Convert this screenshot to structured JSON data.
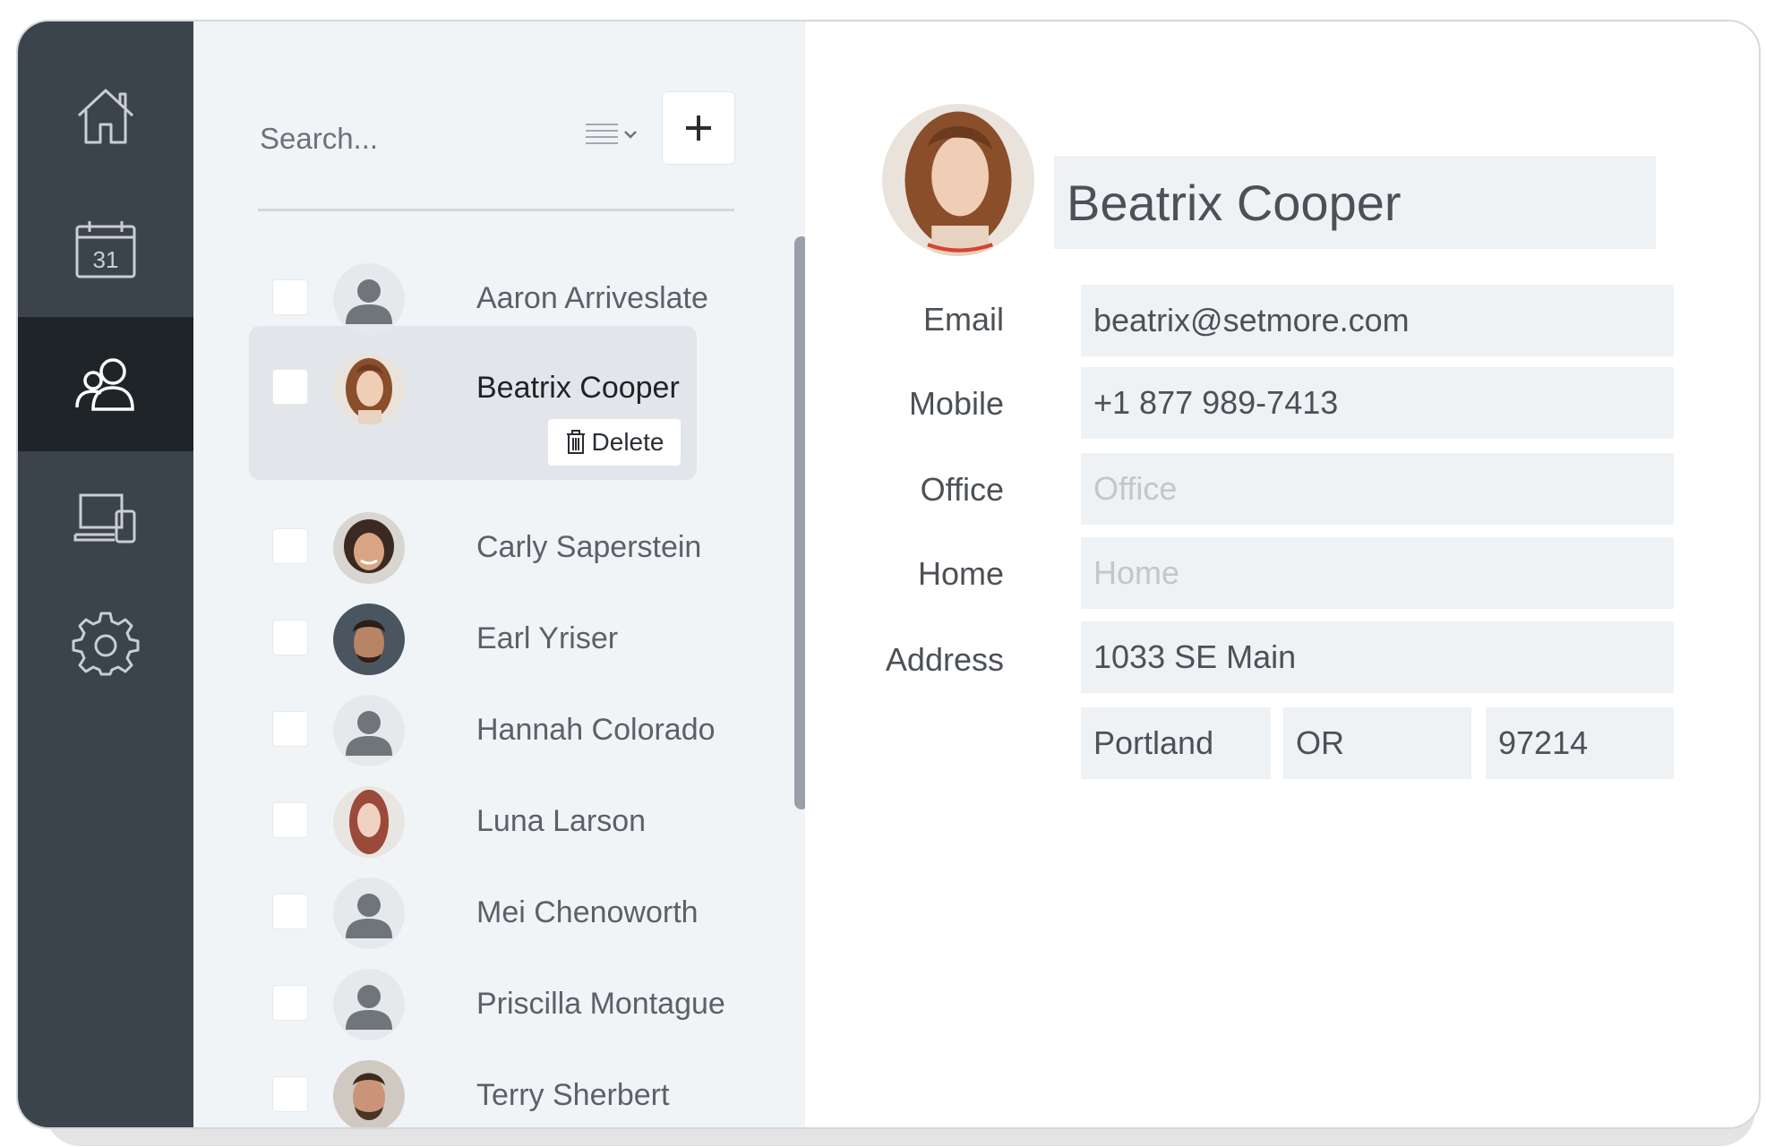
{
  "sidebar": {
    "items": [
      {
        "icon": "home-icon",
        "active": false
      },
      {
        "icon": "calendar-icon",
        "calendar_day": "31",
        "active": false
      },
      {
        "icon": "contacts-icon",
        "active": true
      },
      {
        "icon": "devices-icon",
        "active": false
      },
      {
        "icon": "gear-icon",
        "active": false
      }
    ]
  },
  "list": {
    "search_placeholder": "Search...",
    "add_label": "+",
    "delete_label": "Delete",
    "contacts": [
      {
        "name": "Aaron Arriveslate",
        "avatar": "default"
      },
      {
        "name": "Beatrix Cooper",
        "avatar": "photo",
        "selected": true
      },
      {
        "name": "Carly Saperstein",
        "avatar": "photo"
      },
      {
        "name": "Earl Yriser",
        "avatar": "photo"
      },
      {
        "name": "Hannah Colorado",
        "avatar": "default"
      },
      {
        "name": "Luna Larson",
        "avatar": "photo"
      },
      {
        "name": "Mei Chenoworth",
        "avatar": "default"
      },
      {
        "name": "Priscilla Montague",
        "avatar": "default"
      },
      {
        "name": "Terry Sherbert",
        "avatar": "photo"
      }
    ]
  },
  "detail": {
    "name": "Beatrix Cooper",
    "email_label": "Email",
    "email": "beatrix@setmore.com",
    "mobile_label": "Mobile",
    "mobile": "+1 877 989-7413",
    "office_label": "Office",
    "office_placeholder": "Office",
    "home_label": "Home",
    "home_placeholder": "Home",
    "address_label": "Address",
    "address": "1033 SE Main",
    "city": "Portland",
    "state": "OR",
    "zip": "97214"
  },
  "colors": {
    "sidebar": "#3b444d",
    "sidebar_active": "#1f2428",
    "list_bg": "#f1f4f7",
    "field_bg": "#eef2f5"
  }
}
